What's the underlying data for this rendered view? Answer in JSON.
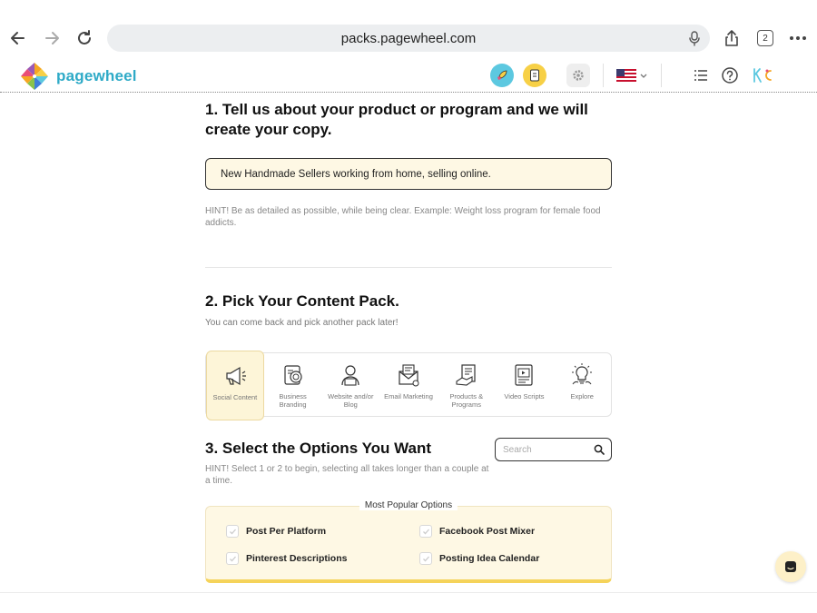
{
  "browser": {
    "url": "packs.pagewheel.com",
    "tab_count": "2"
  },
  "header": {
    "logo_text": "pagewheel",
    "brand_color": "#2eaac7",
    "accent_yellow": "#f5d35a",
    "accent_cyan": "#5cc8e0",
    "icons": [
      "rocket-icon",
      "document-icon",
      "gear-icon",
      "us-flag-icon",
      "chevron-down-icon",
      "list-icon",
      "help-icon",
      "avatar"
    ]
  },
  "step1": {
    "title": "1. Tell us about your product or program and we will create your copy.",
    "input_value": "New Handmade Sellers working from home, selling online.",
    "hint": "HINT! Be as detailed as possible, while being clear. Example: Weight loss program for female food addicts."
  },
  "step2": {
    "title": "2. Pick Your Content Pack.",
    "subtitle": "You can come back and pick another pack later!",
    "packs": [
      {
        "label": "Social Content",
        "icon": "megaphone-icon",
        "active": true
      },
      {
        "label": "Business Branding",
        "icon": "branding-icon",
        "active": false
      },
      {
        "label": "Website and/or Blog",
        "icon": "website-icon",
        "active": false
      },
      {
        "label": "Email Marketing",
        "icon": "email-icon",
        "active": false
      },
      {
        "label": "Products & Programs",
        "icon": "products-icon",
        "active": false
      },
      {
        "label": "Video Scripts",
        "icon": "video-icon",
        "active": false
      },
      {
        "label": "Explore",
        "icon": "lightbulb-icon",
        "active": false
      }
    ]
  },
  "step3": {
    "title": "3. Select the Options You Want",
    "search_placeholder": "Search",
    "hint": "HINT! Select 1 or 2 to begin, selecting all takes longer than a couple at a time.",
    "options_title": "Most Popular Options",
    "options": [
      {
        "label": "Post Per Platform"
      },
      {
        "label": "Facebook Post Mixer"
      },
      {
        "label": "Pinterest Descriptions"
      },
      {
        "label": "Posting Idea Calendar"
      }
    ]
  }
}
